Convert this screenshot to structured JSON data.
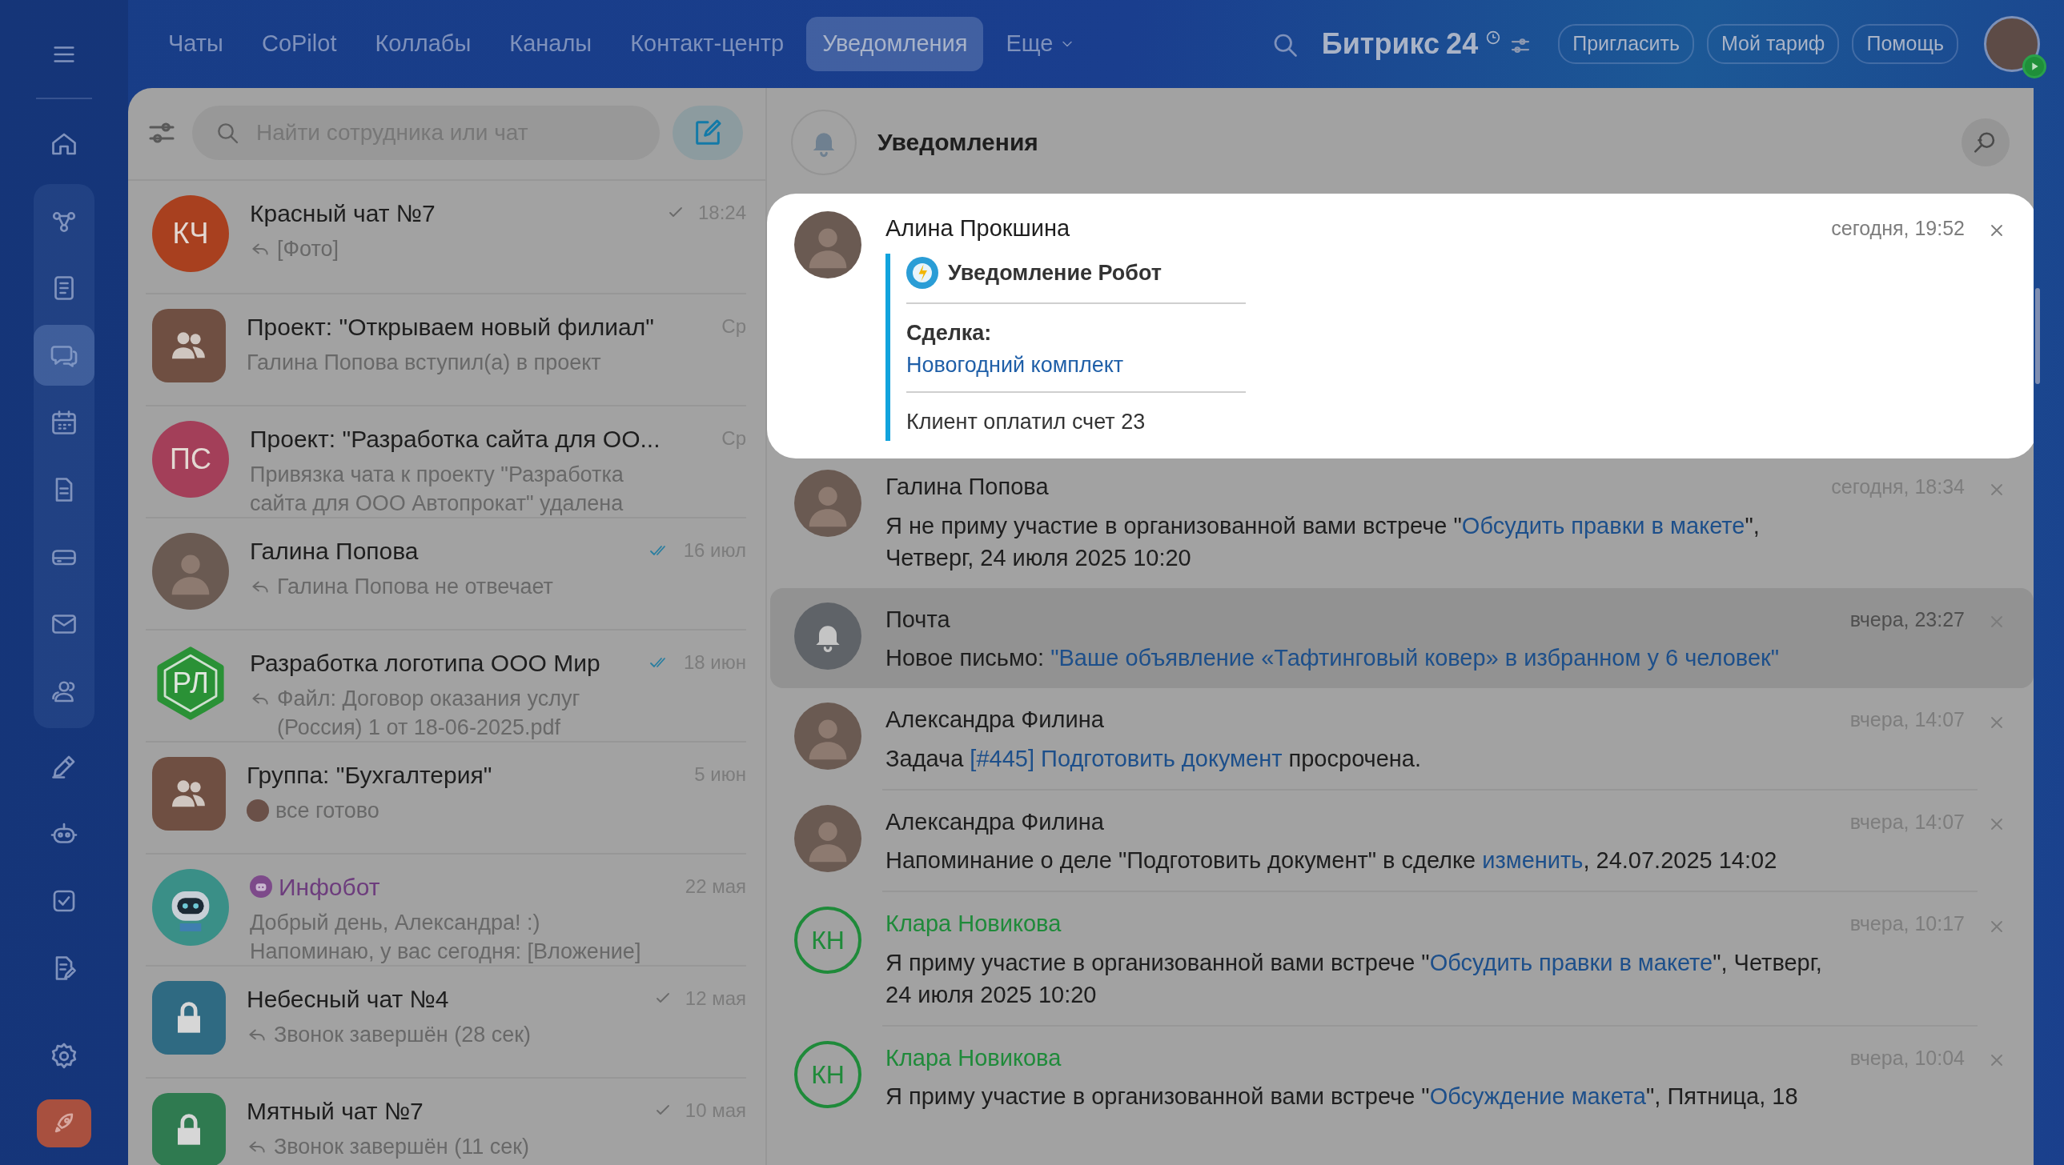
{
  "top_nav": {
    "tabs": [
      {
        "label": "Чаты",
        "selected": false
      },
      {
        "label": "CoPilot",
        "selected": false
      },
      {
        "label": "Коллабы",
        "selected": false
      },
      {
        "label": "Каналы",
        "selected": false
      },
      {
        "label": "Контакт-центр",
        "selected": false
      },
      {
        "label": "Уведомления",
        "selected": true
      }
    ],
    "more": "Еще",
    "logo": {
      "name": "Битрикс",
      "number": "24"
    },
    "buttons": [
      "Пригласить",
      "Мой тариф",
      "Помощь"
    ]
  },
  "sidebar": {
    "items": [
      {
        "selected": false
      },
      {
        "selected": false
      },
      {
        "selected": false
      },
      {
        "selected": true
      },
      {
        "selected": false
      },
      {
        "selected": false
      },
      {
        "selected": false
      },
      {
        "selected": false
      },
      {
        "selected": false
      },
      {
        "selected": false
      },
      {
        "selected": false
      },
      {
        "selected": false
      },
      {
        "selected": false
      }
    ]
  },
  "chat_list": {
    "search": {
      "placeholder": "Найти сотрудника или чат"
    },
    "items": [
      {
        "avatar": {
          "kind": "initials",
          "text": "КЧ",
          "color": "#a8401f"
        },
        "title": "Красный чат №7",
        "bot": false,
        "time": "18:24",
        "delivered": true,
        "read": false,
        "preview": "[Фото]",
        "reply": true
      },
      {
        "avatar": {
          "kind": "group",
          "color": "#6f4f42"
        },
        "title": "Проект: \"Открываем новый филиал\"",
        "bot": false,
        "time": "Ср",
        "delivered": false,
        "preview": "Галина Попова вступил(а) в проект",
        "reply": false
      },
      {
        "avatar": {
          "kind": "initials",
          "text": "ПС",
          "color": "#a33f59"
        },
        "title": "Проект: \"Разработка сайта для ОО...",
        "bot": false,
        "time": "Ср",
        "delivered": false,
        "preview": "Привязка чата к проекту \"Разработка\nсайта для ООО Автопрокат\" удалена",
        "reply": false
      },
      {
        "avatar": {
          "kind": "photo"
        },
        "title": "Галина Попова",
        "bot": false,
        "time": "16 июл",
        "delivered": true,
        "read": true,
        "preview": "Галина Попова не отвечает",
        "reply": true
      },
      {
        "avatar": {
          "kind": "hexagon",
          "text": "РЛ",
          "color": "#2a9136"
        },
        "title": "Разработка логотипа ООО Мир",
        "bot": false,
        "time": "18 июн",
        "delivered": true,
        "read": true,
        "preview": "Файл: Договор оказания услуг\n(Россия) 1 от 18-06-2025.pdf",
        "reply": true
      },
      {
        "avatar": {
          "kind": "group",
          "color": "#6f4f42"
        },
        "title": "Группа: \"Бухгалтерия\"",
        "bot": false,
        "time": "5 июн",
        "delivered": false,
        "preview": "все готово",
        "reply": false,
        "sender_avatar": true
      },
      {
        "avatar": {
          "kind": "bot"
        },
        "title": "Инфобот",
        "bot": true,
        "time": "22 мая",
        "delivered": false,
        "preview": "Добрый день, Александра! :)\nНапоминаю, у вас сегодня: [Вложение]",
        "reply": false
      },
      {
        "avatar": {
          "kind": "lock",
          "color": "#2f6a82"
        },
        "title": "Небесный чат №4",
        "bot": false,
        "time": "12 мая",
        "delivered": true,
        "read": false,
        "preview": "Звонок завершён (28 сек)",
        "reply": true
      },
      {
        "avatar": {
          "kind": "lock",
          "color": "#2f7a50"
        },
        "title": "Мятный чат №7",
        "bot": false,
        "time": "10 мая",
        "delivered": true,
        "read": false,
        "preview": "Звонок завершён (11 сек)",
        "reply": true
      }
    ]
  },
  "notifications": {
    "title": "Уведомления",
    "items": [
      {
        "kind": "attachment",
        "focused": true,
        "unread": false,
        "avatar": {
          "kind": "photo"
        },
        "author": "Алина Прокшина",
        "time": "сегодня, 19:52",
        "attachment": {
          "title": "Уведомление Робот",
          "label": "Сделка:",
          "link": "Новогодний комплект",
          "text": "Клиент оплатил счет 23"
        }
      },
      {
        "kind": "message",
        "focused": false,
        "unread": false,
        "avatar": {
          "kind": "photo"
        },
        "author": "Галина Попова",
        "time": "сегодня, 18:34",
        "parts": [
          {
            "kind": "text",
            "text": "Я не приму участие в организованной вами встрече \""
          },
          {
            "kind": "link",
            "text": "Обсудить правки в макете"
          },
          {
            "kind": "text",
            "text": "\", Четверг, 24 июля 2025 10:20"
          }
        ]
      },
      {
        "kind": "message",
        "focused": false,
        "unread": true,
        "avatar": {
          "kind": "bell"
        },
        "author": "Почта",
        "time": "вчера, 23:27",
        "parts": [
          {
            "kind": "text",
            "text": "Новое письмо: "
          },
          {
            "kind": "link",
            "text": "\"Ваше объявление «Тафтинговый ковер» в избранном у 6 человек\""
          }
        ]
      },
      {
        "kind": "message",
        "focused": false,
        "unread": false,
        "avatar": {
          "kind": "photo"
        },
        "author": "Александра Филина",
        "time": "вчера, 14:07",
        "parts": [
          {
            "kind": "text",
            "text": "Задача "
          },
          {
            "kind": "link",
            "text": "[#445] Подготовить документ"
          },
          {
            "kind": "text",
            "text": " просрочена."
          }
        ]
      },
      {
        "kind": "message",
        "focused": false,
        "unread": false,
        "avatar": {
          "kind": "photo"
        },
        "author": "Александра Филина",
        "time": "вчера, 14:07",
        "parts": [
          {
            "kind": "text",
            "text": "Напоминание о деле \"Подготовить документ\" в сделке "
          },
          {
            "kind": "link",
            "text": "изменить"
          },
          {
            "kind": "text",
            "text": ", 24.07.2025 14:02"
          }
        ]
      },
      {
        "kind": "message",
        "focused": false,
        "unread": false,
        "avatar": {
          "kind": "initials",
          "text": "КН"
        },
        "color": "#1f8a3a",
        "author": "Клара Новикова",
        "time": "вчера, 10:17",
        "parts": [
          {
            "kind": "text",
            "text": "Я приму участие в организованной вами встрече \""
          },
          {
            "kind": "link",
            "text": "Обсудить правки в макете"
          },
          {
            "kind": "text",
            "text": "\", Четверг, 24 июля 2025 10:20"
          }
        ]
      },
      {
        "kind": "message",
        "focused": false,
        "unread": false,
        "avatar": {
          "kind": "initials",
          "text": "КН"
        },
        "color": "#1f8a3a",
        "author": "Клара Новикова",
        "time": "вчера, 10:04",
        "parts": [
          {
            "kind": "text",
            "text": "Я приму участие в организованной вами встрече \""
          },
          {
            "kind": "link",
            "text": "Обсуждение макета"
          },
          {
            "kind": "text",
            "text": "\", Пятница, 18"
          }
        ]
      }
    ]
  }
}
